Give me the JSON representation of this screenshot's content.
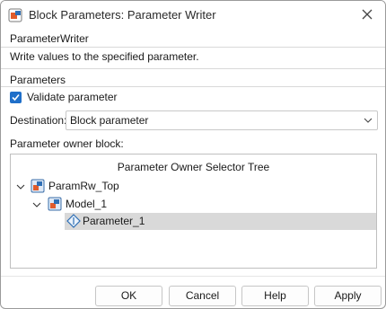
{
  "window": {
    "title": "Block Parameters: Parameter Writer"
  },
  "block": {
    "heading": "ParameterWriter",
    "description": "Write values to the specified parameter."
  },
  "parameters": {
    "heading": "Parameters",
    "validate_label": "Validate parameter",
    "validate_checked": true,
    "destination_label": "Destination:",
    "destination_value": "Block parameter",
    "owner_label": "Parameter owner block:"
  },
  "tree": {
    "title": "Parameter Owner Selector Tree",
    "nodes": [
      {
        "label": "ParamRw_Top",
        "expanded": true,
        "icon": "model-icon",
        "selected": false
      },
      {
        "label": "Model_1",
        "expanded": true,
        "icon": "model-icon",
        "selected": false
      },
      {
        "label": "Parameter_1",
        "icon": "parameter-diamond-icon",
        "selected": true
      }
    ]
  },
  "buttons": {
    "ok": "OK",
    "cancel": "Cancel",
    "help": "Help",
    "apply": "Apply"
  },
  "colors": {
    "accent": "#1f6fc9",
    "selection": "#d9d9d9"
  }
}
